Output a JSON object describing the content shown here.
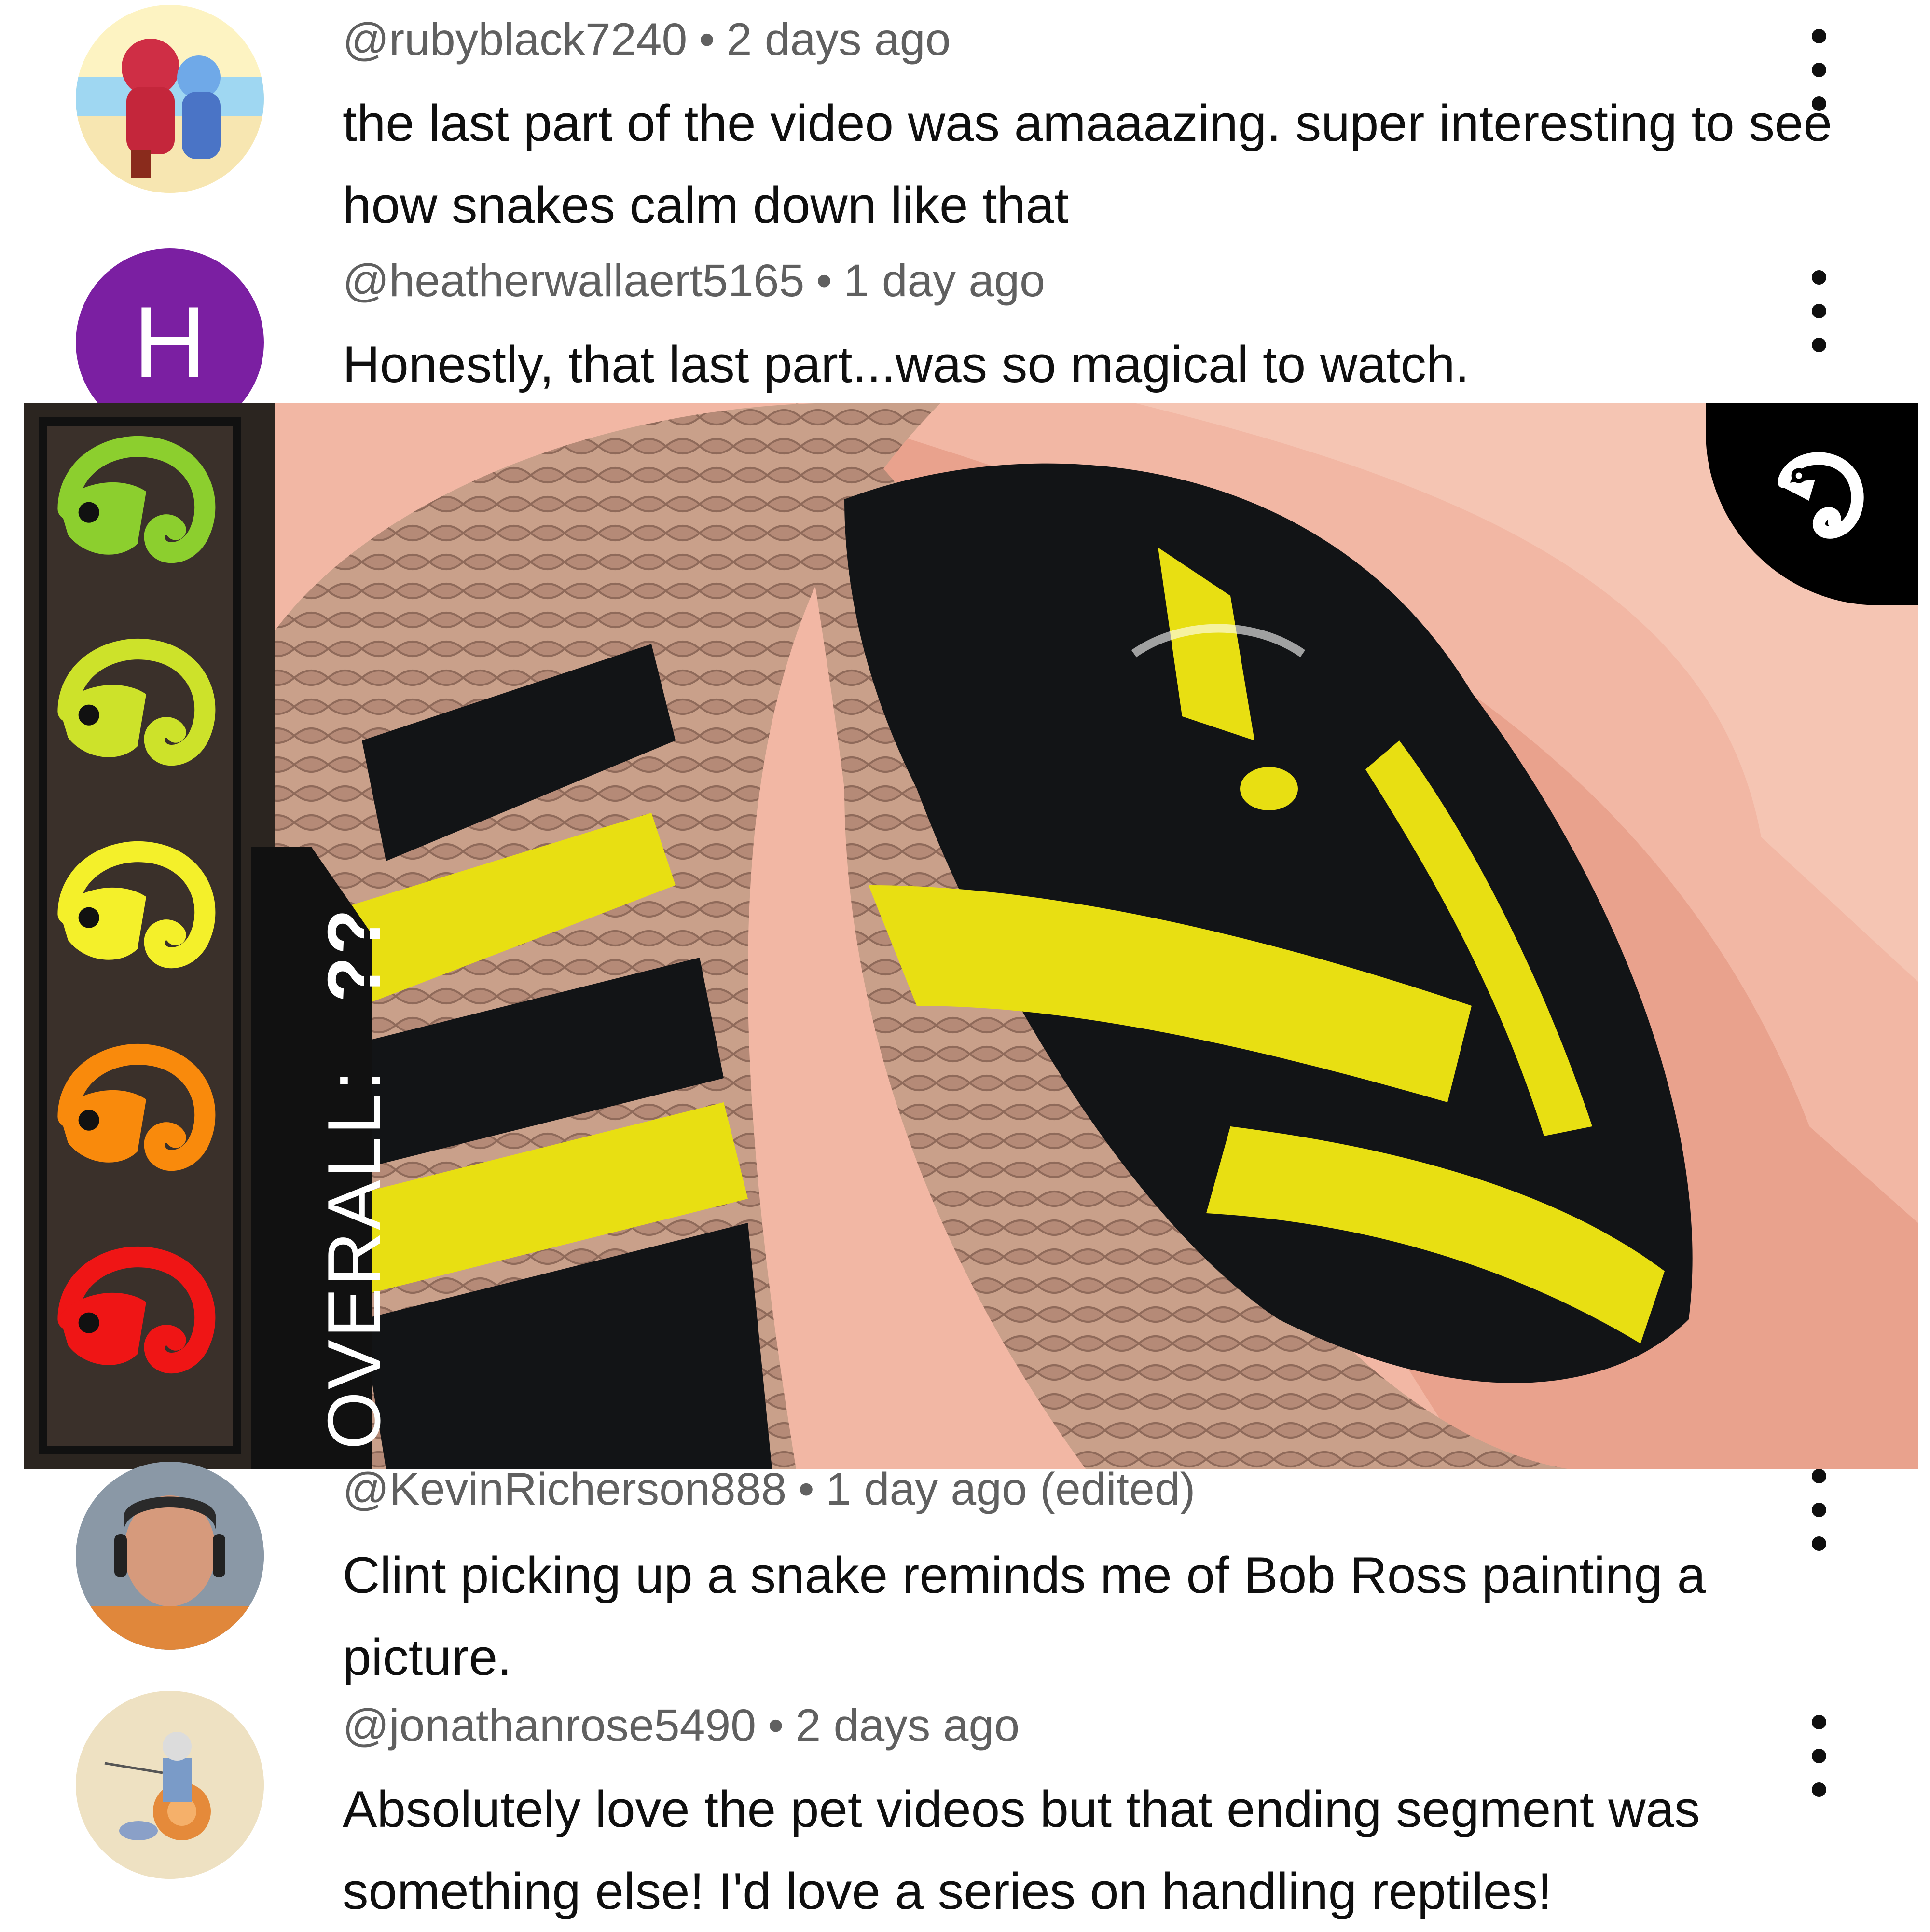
{
  "comments": [
    {
      "author": "@rubyblack7240",
      "time": "2 days ago",
      "text": "the last part of the video was amaaazing. super interesting to see how snakes calm down like that"
    },
    {
      "author": "@heatherwallaert5165",
      "time": "1 day ago",
      "text": "Honestly, that last part...was so magical to watch.",
      "avatar_letter": "H"
    },
    {
      "author": "@KevinRicherson888",
      "time": "1 day ago (edited)",
      "text": "Clint picking up a snake reminds me of Bob Ross painting a picture."
    },
    {
      "author": "@jonathanrose5490",
      "time": "2 days ago",
      "text": "Absolutely love the pet videos but that ending segment was something else! I'd love a series on handling reptiles!"
    }
  ],
  "meta_separator": "•",
  "thumbnail": {
    "overall_label": "OVERALL:",
    "overall_value": "??",
    "rating_icon": "chameleon-icon",
    "rating_colors": [
      "#8ccf2e",
      "#cde22a",
      "#f4f02a",
      "#f98a0c",
      "#ef1515"
    ],
    "badge_icon": "chameleon-icon"
  },
  "colors": {
    "avatar_h": "#7b1fa2",
    "snake_yellow": "#e8df12",
    "snake_black": "#121416",
    "skin": "#f2b7a4"
  }
}
